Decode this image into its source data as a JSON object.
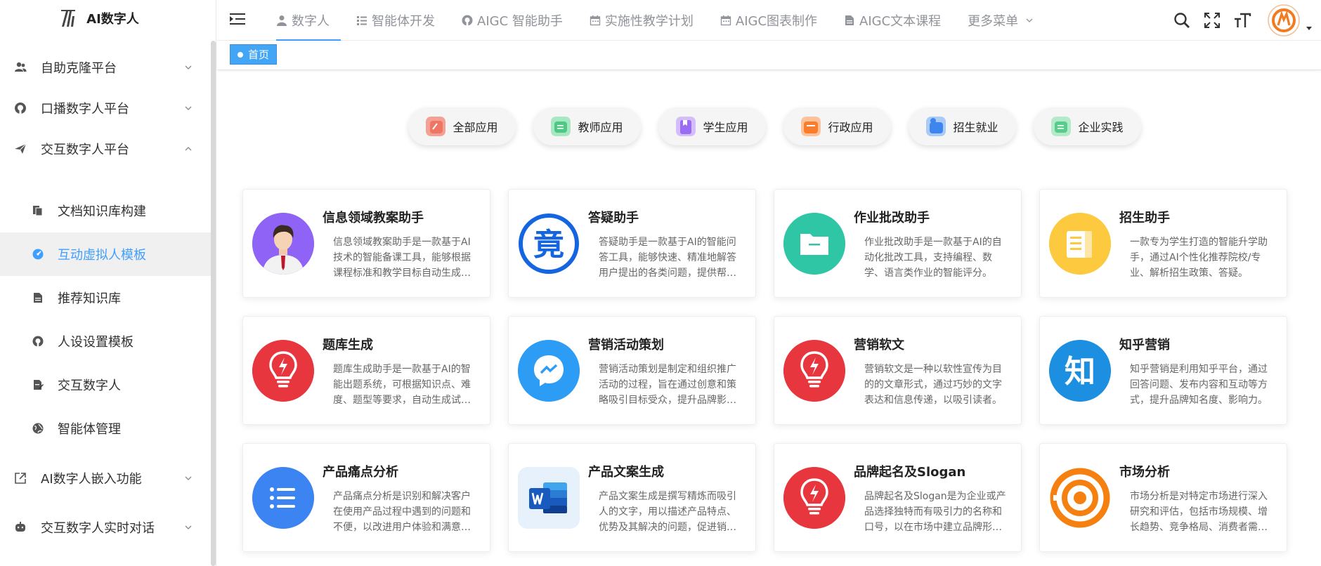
{
  "logo": {
    "text": "AI数字人"
  },
  "sidebar": {
    "groups": [
      {
        "label": "自助克隆平台",
        "icon": "users-icon",
        "expanded": false
      },
      {
        "label": "口播数字人平台",
        "icon": "github-icon",
        "expanded": false
      },
      {
        "label": "交互数字人平台",
        "icon": "send-icon",
        "expanded": true
      }
    ],
    "subitems": [
      {
        "label": "文档知识库构建",
        "icon": "documents-icon"
      },
      {
        "label": "互动虚拟人模板",
        "icon": "dashboard-icon",
        "active": true
      },
      {
        "label": "推荐知识库",
        "icon": "file-text-icon"
      },
      {
        "label": "人设设置模板",
        "icon": "github-icon"
      },
      {
        "label": "交互数字人",
        "icon": "file-edit-icon"
      },
      {
        "label": "智能体管理",
        "icon": "globe-icon"
      }
    ],
    "tail": [
      {
        "label": "AI数字人嵌入功能",
        "icon": "external-link-icon"
      },
      {
        "label": "交互数字人实时对话",
        "icon": "robot-icon"
      }
    ]
  },
  "nav": {
    "items": [
      {
        "label": "数字人",
        "icon": "user-icon",
        "active": true
      },
      {
        "label": "智能体开发",
        "icon": "list-icon"
      },
      {
        "label": "AIGC 智能助手",
        "icon": "github-icon"
      },
      {
        "label": "实施性教学计划",
        "icon": "calendar-icon"
      },
      {
        "label": "AIGC图表制作",
        "icon": "calendar-icon"
      },
      {
        "label": "AIGC文本课程",
        "icon": "file-icon"
      }
    ],
    "more": "更多菜单"
  },
  "tags": {
    "home": "首页"
  },
  "categories": [
    {
      "label": "全部应用",
      "color": "#f28b7d"
    },
    {
      "label": "教师应用",
      "color": "#5bd28f"
    },
    {
      "label": "学生应用",
      "color": "#a77df5"
    },
    {
      "label": "行政应用",
      "color": "#fb8a3c"
    },
    {
      "label": "招生就业",
      "color": "#4a90f0"
    },
    {
      "label": "企业实践",
      "color": "#66d39a"
    }
  ],
  "cards": [
    {
      "title": "信息领域教案助手",
      "desc": "信息领域教案助手是一款基于AI技术的智能备课工具，能够根据课程标准和教学目标自动生成教案。",
      "icon": "teacher-avatar-icon",
      "bg": "#8e63f5"
    },
    {
      "title": "答疑助手",
      "desc": "答疑助手是一款基于AI的智能问答工具，能够快速、精准地解答用户提出的各类问题，提供帮助。",
      "icon": "jing-badge-icon",
      "bg": "#ffffff",
      "glyph": "竟"
    },
    {
      "title": "作业批改助手",
      "desc": "作业批改助手是一款基于AI的自动化批改工具，支持编程、数学、语言类作业的智能评分。",
      "icon": "folder-icon",
      "bg": "#2fc6a5"
    },
    {
      "title": "招生助手",
      "desc": "一款专为学生打造的智能升学助手，通过AI个性化推荐院校/专业、解析招生政策、答疑。",
      "icon": "book-icon",
      "bg": "#fcc93f"
    },
    {
      "title": "题库生成",
      "desc": "题库生成助手是一款基于AI的智能出题系统，可根据知识点、难度、题型等要求，自动生成试题。",
      "icon": "lightbulb-icon",
      "bg": "#e8363e"
    },
    {
      "title": "营销活动策划",
      "desc": "营销活动策划是制定和组织推广活动的过程，旨在通过创意和策略吸引目标受众，提升品牌影响。",
      "icon": "messenger-icon",
      "bg": "#2d9cf5"
    },
    {
      "title": "营销软文",
      "desc": "营销软文是一种以软性宣传为目的的文章形式，通过巧妙的文字表达和信息传递，以吸引读者。",
      "icon": "lightbulb-icon",
      "bg": "#e8363e"
    },
    {
      "title": "知乎营销",
      "desc": "知乎营销是利用知乎平台，通过回答问题、发布内容和互动等方式，提升品牌知名度、影响力。",
      "icon": "zhihu-icon",
      "bg": "#1d8fe0",
      "glyph": "知"
    },
    {
      "title": "产品痛点分析",
      "desc": "产品痛点分析是识别和解决客户在使用产品过程中遇到的问题和不便，以改进用户体验和满意度。",
      "icon": "list-bullets-icon",
      "bg": "#3d84f3"
    },
    {
      "title": "产品文案生成",
      "desc": "产品文案生成是撰写精炼而吸引人的文字，用以描述产品特点、优势及其解决的问题，促进销售。",
      "icon": "word-icon",
      "bg": "#e6f1fb"
    },
    {
      "title": "品牌起名及Slogan",
      "desc": "品牌起名及Slogan是为企业或产品选择独特而有吸引力的名称和口号，以在市场中建立品牌形象。",
      "icon": "lightbulb-icon",
      "bg": "#e8363e"
    },
    {
      "title": "市场分析",
      "desc": "市场分析是对特定市场进行深入研究和评估，包括市场规模、增长趋势、竞争格局、消费者需求等。",
      "icon": "target-icon",
      "bg": "#ffffff"
    }
  ],
  "colors": {
    "accent": "#409eff",
    "tag": "#42a5f5"
  }
}
